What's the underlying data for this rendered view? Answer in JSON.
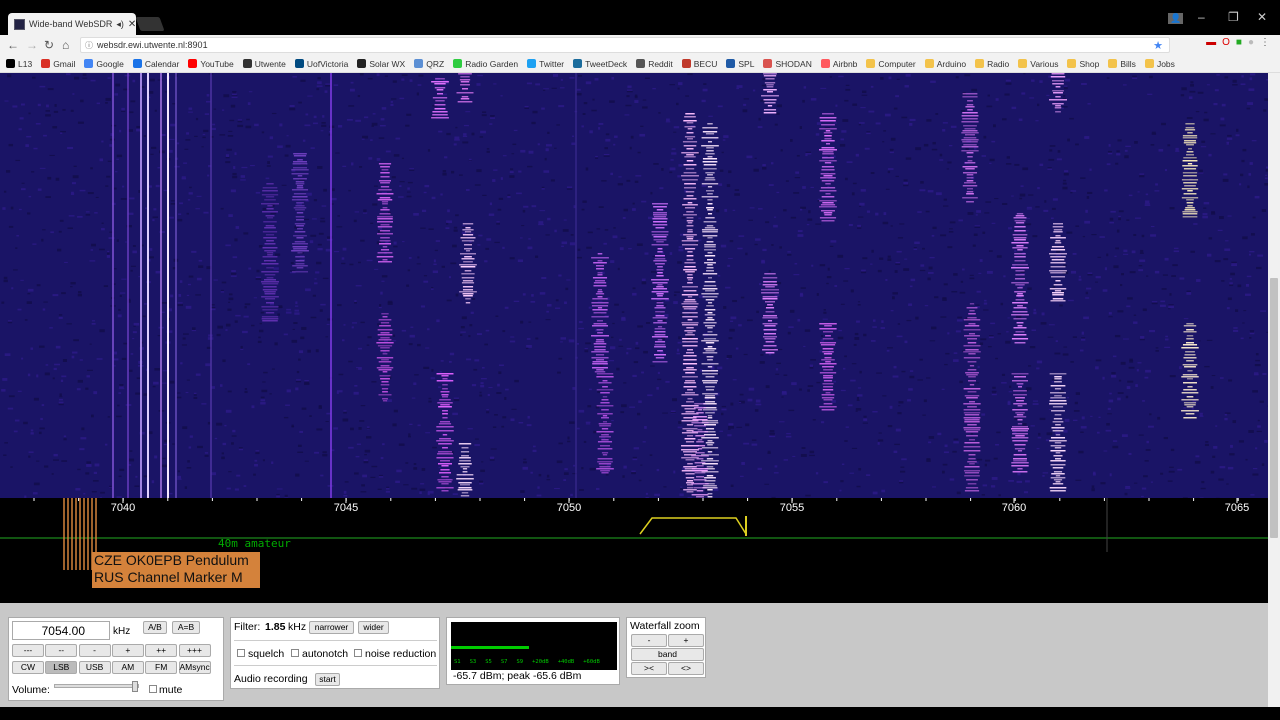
{
  "browser": {
    "tab_title": "Wide-band WebSDR",
    "url": "websdr.ewi.utwente.nl:8901",
    "bookmarks": [
      {
        "label": "L13",
        "icon": "l13-icon",
        "color": "#000000"
      },
      {
        "label": "Gmail",
        "icon": "gmail-icon",
        "color": "#d93025"
      },
      {
        "label": "Google",
        "icon": "google-icon",
        "color": "#4285f4"
      },
      {
        "label": "Calendar",
        "icon": "calendar-icon",
        "color": "#1a73e8"
      },
      {
        "label": "YouTube",
        "icon": "youtube-icon",
        "color": "#ff0000"
      },
      {
        "label": "Utwente",
        "icon": "utwente-icon",
        "color": "#333333"
      },
      {
        "label": "UofVictoria",
        "icon": "uvic-icon",
        "color": "#004a80"
      },
      {
        "label": "Solar WX",
        "icon": "solarwx-icon",
        "color": "#222222"
      },
      {
        "label": "QRZ",
        "icon": "qrz-icon",
        "color": "#5b8fd4"
      },
      {
        "label": "Radio Garden",
        "icon": "radiogarden-icon",
        "color": "#2ecc40"
      },
      {
        "label": "Twitter",
        "icon": "twitter-icon",
        "color": "#1da1f2"
      },
      {
        "label": "TweetDeck",
        "icon": "tweetdeck-icon",
        "color": "#1b6c9c"
      },
      {
        "label": "Reddit",
        "icon": "reddit-icon",
        "color": "#555555"
      },
      {
        "label": "BECU",
        "icon": "becu-icon",
        "color": "#c0392b"
      },
      {
        "label": "SPL",
        "icon": "spl-icon",
        "color": "#1f5aa6"
      },
      {
        "label": "SHODAN",
        "icon": "shodan-icon",
        "color": "#d9534f"
      },
      {
        "label": "Airbnb",
        "icon": "airbnb-icon",
        "color": "#ff5a5f"
      },
      {
        "label": "Computer",
        "icon": "folder-icon",
        "color": "#f3c34b"
      },
      {
        "label": "Arduino",
        "icon": "folder-icon",
        "color": "#f3c34b"
      },
      {
        "label": "Radio",
        "icon": "folder-icon",
        "color": "#f3c34b"
      },
      {
        "label": "Various",
        "icon": "folder-icon",
        "color": "#f3c34b"
      },
      {
        "label": "Shop",
        "icon": "folder-icon",
        "color": "#f3c34b"
      },
      {
        "label": "Bills",
        "icon": "folder-icon",
        "color": "#f3c34b"
      },
      {
        "label": "Jobs",
        "icon": "folder-icon",
        "color": "#f3c34b"
      }
    ]
  },
  "scale": {
    "ticks": [
      "7040",
      "7045",
      "7050",
      "7055",
      "7060",
      "7065"
    ],
    "band_label": "40m amateur",
    "station_lines": [
      "CZE OK0EPB Pendulum",
      "RUS Channel Marker M"
    ]
  },
  "tuning": {
    "frequency": "7054.00",
    "unit": "kHz",
    "ab_button": "A/B",
    "a_eq_b_button": "A=B",
    "step_buttons": [
      "---",
      "--",
      "-",
      "+",
      "++",
      "+++"
    ],
    "modes": [
      "CW",
      "LSB",
      "USB",
      "AM",
      "FM",
      "AMsync"
    ],
    "active_mode": "LSB",
    "volume_label": "Volume:",
    "mute_label": "mute"
  },
  "filter": {
    "label": "Filter:",
    "value": "1.85",
    "unit": "kHz",
    "narrower": "narrower",
    "wider": "wider",
    "squelch": "squelch",
    "autonotch": "autonotch",
    "noise_reduction": "noise reduction",
    "audio_recording": "Audio recording",
    "start": "start"
  },
  "smeter": {
    "scale_labels": [
      "S1",
      "S3",
      "S5",
      "S7",
      "S9",
      "+20dB",
      "+40dB",
      "+60dB"
    ],
    "reading": "-65.7 dBm; peak  -65.6 dBm",
    "level_fraction": 0.47
  },
  "zoom": {
    "title": "Waterfall zoom",
    "minus": "-",
    "plus": "+",
    "band": "band",
    "shrink": "><",
    "expand": "<>"
  }
}
